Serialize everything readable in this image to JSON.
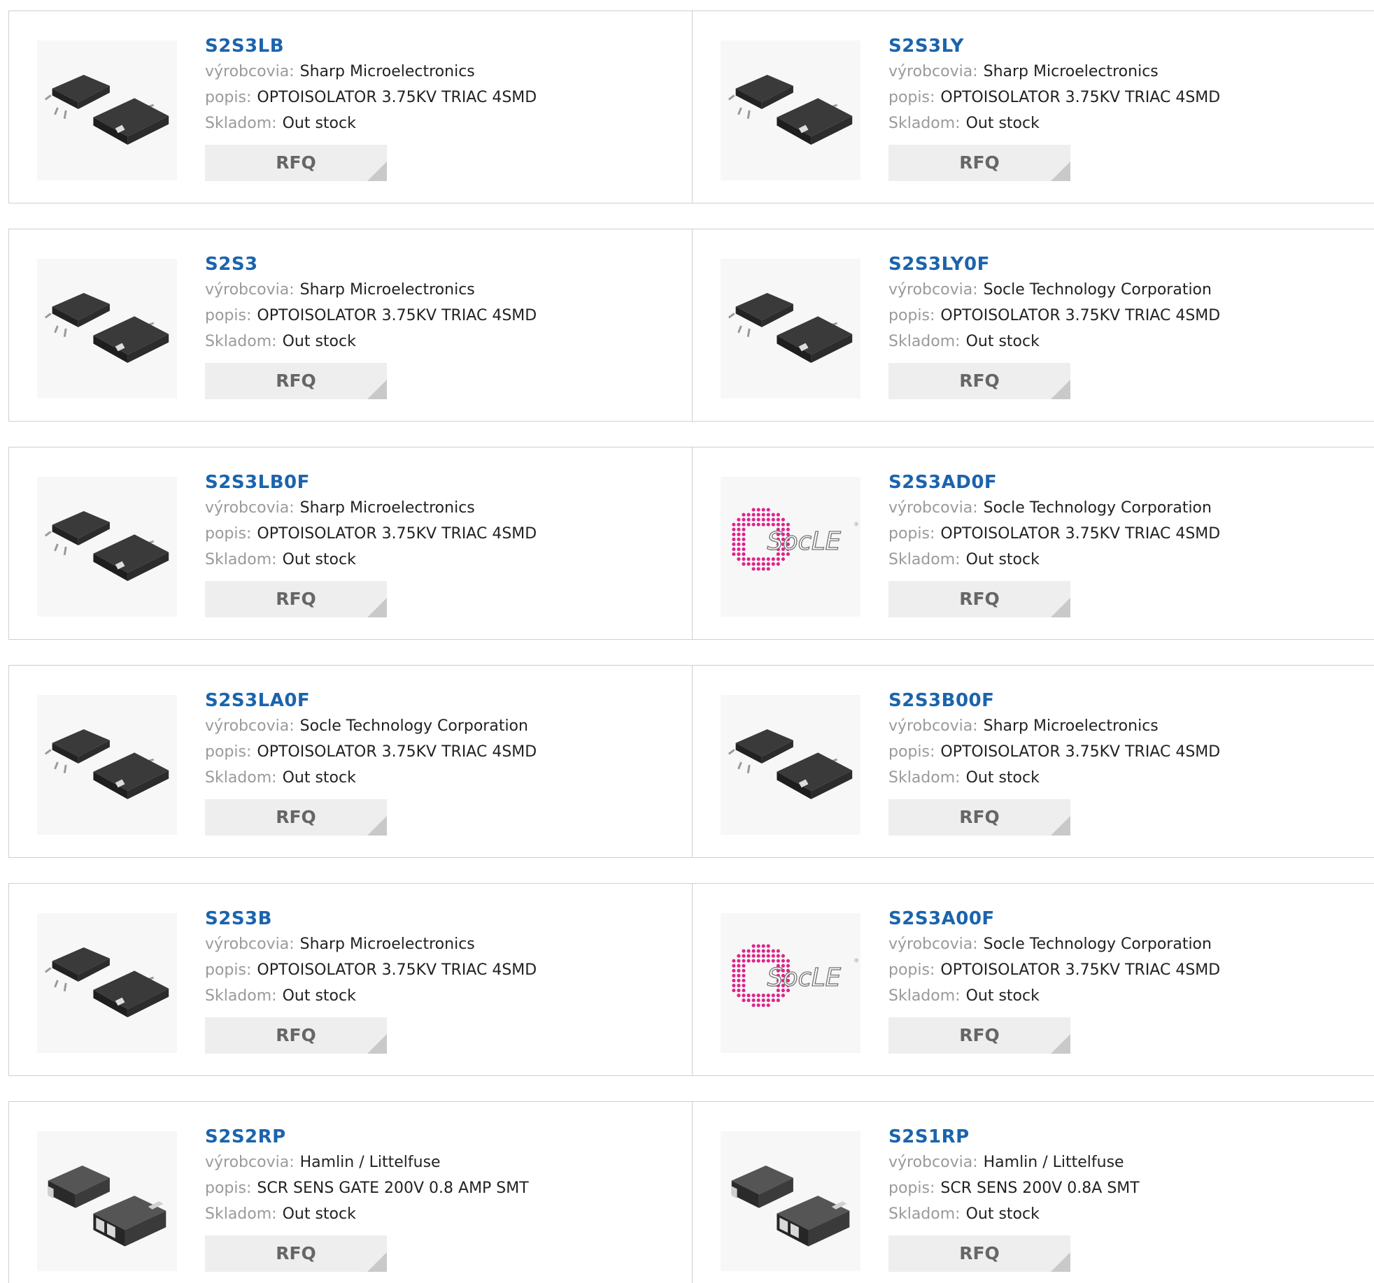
{
  "labels": {
    "manufacturer": "výrobcovia:",
    "description": "popis:",
    "stock": "Skladom:",
    "rfq": "RFQ"
  },
  "rows": [
    [
      {
        "pn": "S2S3LB",
        "mfr": "Sharp Microelectronics",
        "desc": "OPTOISOLATOR 3.75KV TRIAC 4SMD",
        "stock": "Out stock",
        "image": "opto-4smd"
      },
      {
        "pn": "S2S3LY",
        "mfr": "Sharp Microelectronics",
        "desc": "OPTOISOLATOR 3.75KV TRIAC 4SMD",
        "stock": "Out stock",
        "image": "opto-4smd"
      }
    ],
    [
      {
        "pn": "S2S3",
        "mfr": "Sharp Microelectronics",
        "desc": "OPTOISOLATOR 3.75KV TRIAC 4SMD",
        "stock": "Out stock",
        "image": "opto-4smd"
      },
      {
        "pn": "S2S3LY0F",
        "mfr": "Socle Technology Corporation",
        "desc": "OPTOISOLATOR 3.75KV TRIAC 4SMD",
        "stock": "Out stock",
        "image": "opto-4smd"
      }
    ],
    [
      {
        "pn": "S2S3LB0F",
        "mfr": "Sharp Microelectronics",
        "desc": "OPTOISOLATOR 3.75KV TRIAC 4SMD",
        "stock": "Out stock",
        "image": "opto-4smd"
      },
      {
        "pn": "S2S3AD0F",
        "mfr": "Socle Technology Corporation",
        "desc": "OPTOISOLATOR 3.75KV TRIAC 4SMD",
        "stock": "Out stock",
        "image": "socle-logo"
      }
    ],
    [
      {
        "pn": "S2S3LA0F",
        "mfr": "Socle Technology Corporation",
        "desc": "OPTOISOLATOR 3.75KV TRIAC 4SMD",
        "stock": "Out stock",
        "image": "opto-4smd"
      },
      {
        "pn": "S2S3B00F",
        "mfr": "Sharp Microelectronics",
        "desc": "OPTOISOLATOR 3.75KV TRIAC 4SMD",
        "stock": "Out stock",
        "image": "opto-4smd"
      }
    ],
    [
      {
        "pn": "S2S3B",
        "mfr": "Sharp Microelectronics",
        "desc": "OPTOISOLATOR 3.75KV TRIAC 4SMD",
        "stock": "Out stock",
        "image": "opto-4smd"
      },
      {
        "pn": "S2S3A00F",
        "mfr": "Socle Technology Corporation",
        "desc": "OPTOISOLATOR 3.75KV TRIAC 4SMD",
        "stock": "Out stock",
        "image": "socle-logo"
      }
    ],
    [
      {
        "pn": "S2S2RP",
        "mfr": "Hamlin / Littelfuse",
        "desc": "SCR SENS GATE 200V 0.8 AMP SMT",
        "stock": "Out stock",
        "image": "scr-smt"
      },
      {
        "pn": "S2S1RP",
        "mfr": "Hamlin / Littelfuse",
        "desc": "SCR SENS 200V 0.8A SMT",
        "stock": "Out stock",
        "image": "scr-smt"
      }
    ]
  ],
  "logo_text": "SocLE"
}
